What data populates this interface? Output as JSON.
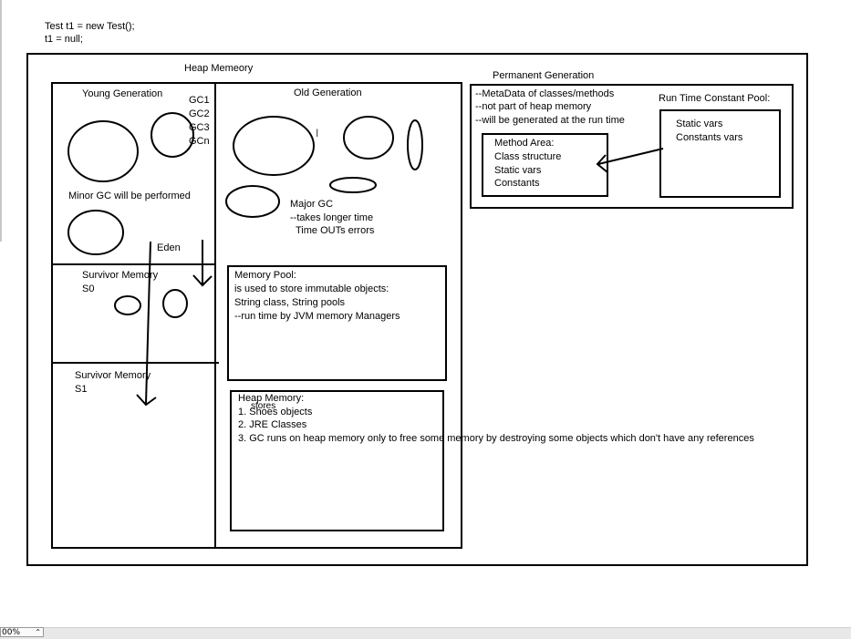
{
  "code": {
    "line1": "Test t1 = new Test();",
    "line2": "t1 = null;"
  },
  "heap": {
    "title": "Heap Memeory",
    "young": {
      "title": "Young Generation",
      "gc_labels": [
        "GC1",
        "GC2",
        "GC3",
        "GCn"
      ],
      "minor_gc": "Minor GC will be performed",
      "eden": "Eden"
    },
    "survivor0": {
      "title": "Survivor Memory",
      "sub": "S0"
    },
    "survivor1": {
      "title": "Survivor Memory",
      "sub": "S1"
    },
    "old": {
      "title": "Old Generation",
      "major_gc": "Major GC",
      "note1": "--takes longer time",
      "note2": "Time OUTs errors"
    },
    "memory_pool": {
      "lines": [
        "Memory Pool:",
        "is used to store immutable objects:",
        "String class, String pools",
        "--run time by JVM memory Managers"
      ]
    },
    "heap_memory_note": {
      "title": "Heap Memory:",
      "overlay": "stores",
      "items": [
        "1. Shoes objects",
        "2. JRE Classes",
        "3. GC runs on heap memory only to free some memory by destroying some objects which don't have any references"
      ]
    }
  },
  "perm": {
    "title": "Permanent Generation",
    "notes": [
      "--MetaData of classes/methods",
      "--not part of heap memory",
      "--will be generated at the run time"
    ],
    "method_area": [
      "Method Area:",
      "Class structure",
      "Static vars",
      "Constants"
    ],
    "rtcp_title": "Run Time Constant Pool:",
    "rtcp_items": [
      "Static vars",
      "Constants vars"
    ]
  },
  "cursor_glyph": "I",
  "status": {
    "zoom": "00%",
    "zoom_arrow": "⌃"
  }
}
